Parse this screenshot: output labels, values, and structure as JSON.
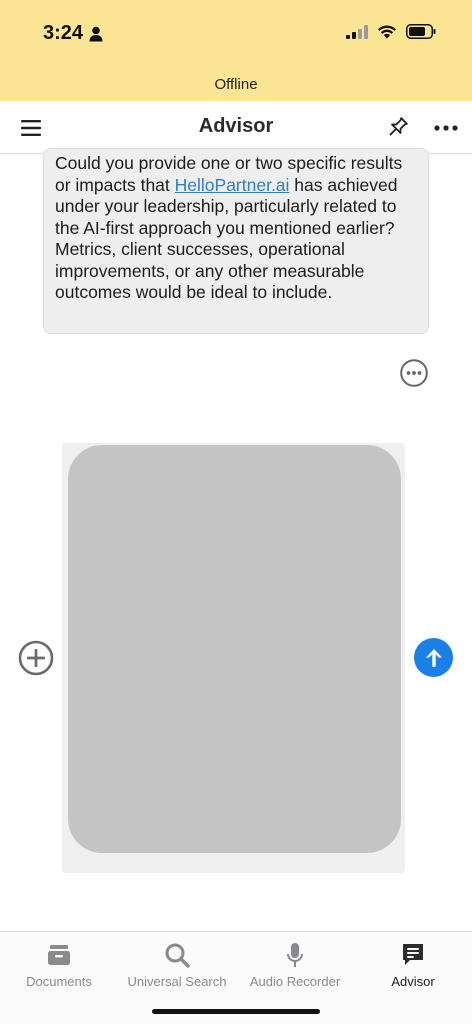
{
  "status_bar": {
    "time": "3:24",
    "banner": "Offline"
  },
  "nav": {
    "title": "Advisor"
  },
  "message": {
    "text_before_link": "Could you provide one or two specific results or impacts that ",
    "link_text": "HelloPartner.ai",
    "text_after_link": " has achieved under your leadership, particularly related to the AI-first approach you mentioned earlier? Metrics, client successes, operational improvements, or any other measurable outcomes would be ideal to include."
  },
  "tabs": [
    {
      "label": "Documents",
      "icon": "documents-icon"
    },
    {
      "label": "Universal Search",
      "icon": "search-icon"
    },
    {
      "label": "Audio Recorder",
      "icon": "microphone-icon"
    },
    {
      "label": "Advisor",
      "icon": "advisor-icon",
      "active": true
    }
  ],
  "colors": {
    "status_bg": "#fbe595",
    "link": "#2f7fc1",
    "send_button": "#1a7fe6",
    "composer_input": "#c4c4c4"
  }
}
